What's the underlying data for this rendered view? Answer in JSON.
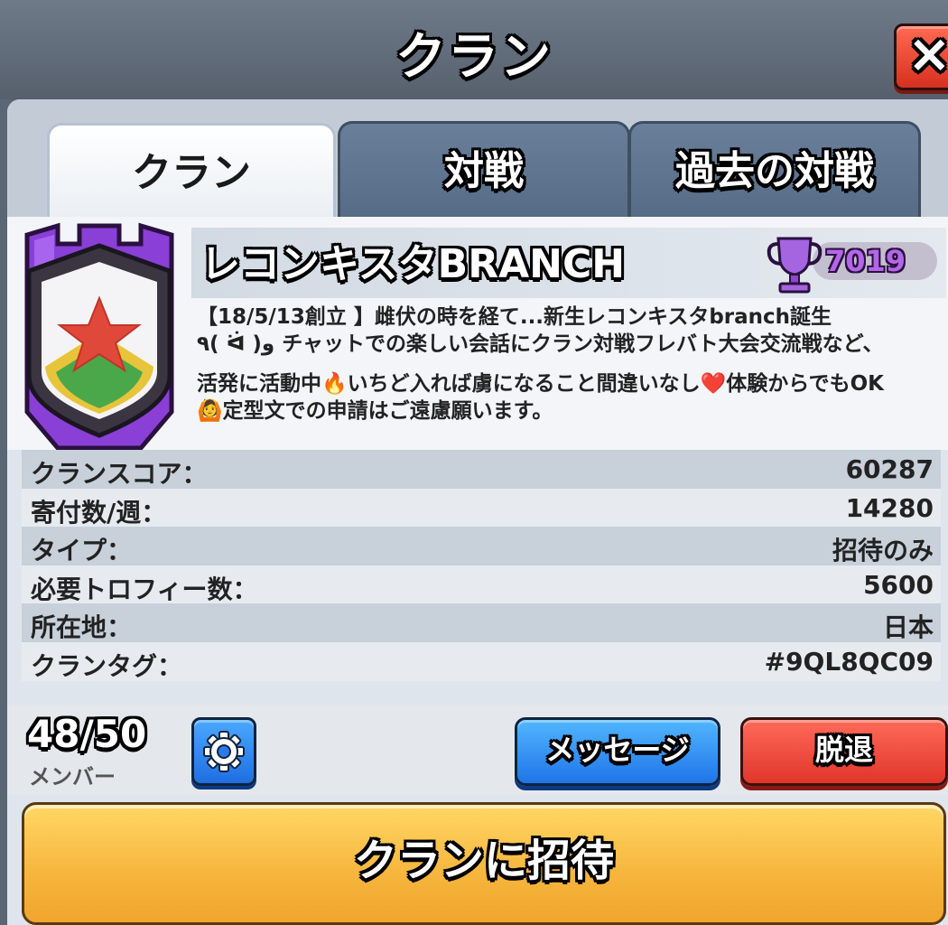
{
  "header": {
    "title": "クラン",
    "close_label": "×"
  },
  "tabs": [
    {
      "label": "クラン",
      "active": true
    },
    {
      "label": "対戦",
      "active": false
    },
    {
      "label": "過去の対戦",
      "active": false
    }
  ],
  "clan": {
    "name": "レコンキスタBRANCH",
    "trophies": "7019",
    "badge_icon": "purple-castle-star-badge",
    "description_lines": [
      "【18/5/13創立 】雌伏の時を経て...新生レコンキスタbranch誕生",
      "٩( ᐛ )و チャットでの楽しい会話にクラン対戦フレバト大会交流戦など、",
      "活発に活動中🔥いちど入れば虜になること間違いなし❤️体験からでもOK",
      "🙆定型文での申請はご遠慮願います。"
    ]
  },
  "stats": [
    {
      "label": "クランスコア：",
      "value": "60287"
    },
    {
      "label": "寄付数/週：",
      "value": "14280"
    },
    {
      "label": "タイプ：",
      "value": "招待のみ"
    },
    {
      "label": "必要トロフィー数：",
      "value": "5600"
    },
    {
      "label": "所在地：",
      "value": "日本"
    },
    {
      "label": "クランタグ：",
      "value": "#9QL8QC09"
    }
  ],
  "members": {
    "count": "48/50",
    "label": "メンバー"
  },
  "buttons": {
    "settings_icon": "gear-icon",
    "message": "メッセージ",
    "leave": "脱退",
    "invite": "クランに招待"
  },
  "colors": {
    "accent_blue": "#1f75e8",
    "leave_red": "#e0362a",
    "invite_orange": "#f6b53c",
    "trophy_purple": "#b466e8"
  }
}
